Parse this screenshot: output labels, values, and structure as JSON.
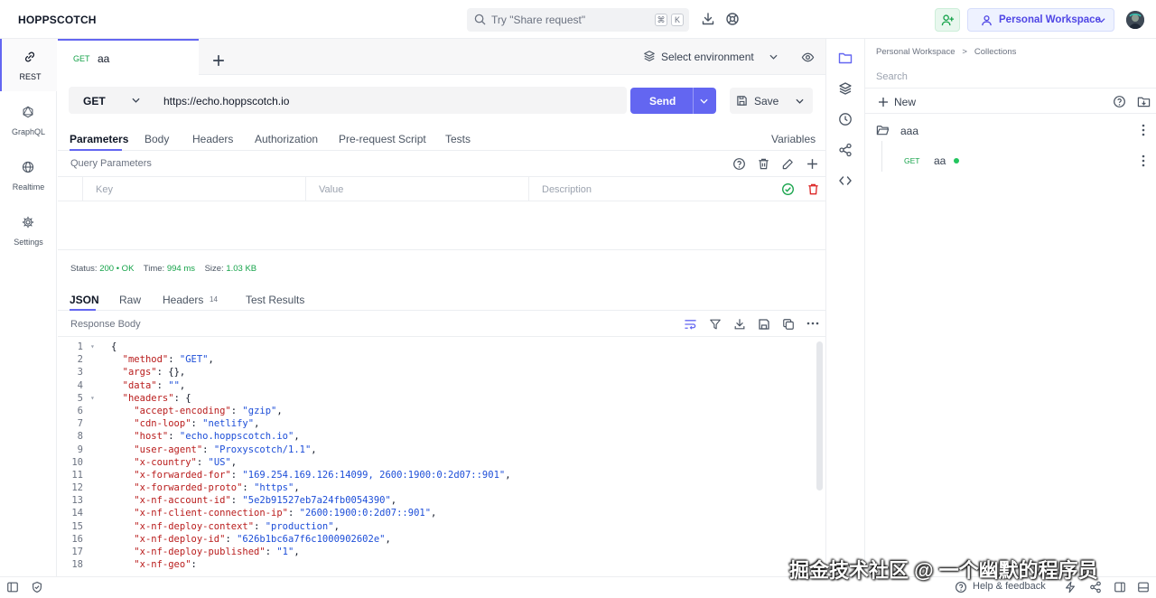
{
  "app": {
    "brand": "HOPPSCOTCH"
  },
  "header": {
    "search_placeholder": "Try \"Share request\"",
    "kbd_1": "⌘",
    "kbd_2": "K",
    "workspace_label": "Personal Workspace"
  },
  "leftnav": [
    {
      "label": "REST",
      "icon": "link-icon"
    },
    {
      "label": "GraphQL",
      "icon": "graphql-icon"
    },
    {
      "label": "Realtime",
      "icon": "globe-icon"
    },
    {
      "label": "Settings",
      "icon": "gear-icon"
    }
  ],
  "request_tab": {
    "method": "GET",
    "name": "aa"
  },
  "environment": {
    "label": "Select environment"
  },
  "urlbar": {
    "method": "GET",
    "url": "https://echo.hoppscotch.io",
    "send_label": "Send",
    "save_label": "Save"
  },
  "request_tabs": [
    "Parameters",
    "Body",
    "Headers",
    "Authorization",
    "Pre-request Script",
    "Tests"
  ],
  "variables_label": "Variables",
  "query_params": {
    "label": "Query Parameters",
    "key_placeholder": "Key",
    "value_placeholder": "Value",
    "description_placeholder": "Description"
  },
  "status": {
    "status_label": "Status:",
    "status_value": "200 • OK",
    "time_label": "Time:",
    "time_value": "994 ms",
    "size_label": "Size:",
    "size_value": "1.03 KB"
  },
  "response_tabs": [
    "JSON",
    "Raw",
    "Headers",
    "Test Results"
  ],
  "response_headers_count": "14",
  "response_body_label": "Response Body",
  "code_lines": [
    {
      "n": "1",
      "fold": "▾",
      "indent": 0,
      "key": "",
      "rest": "{"
    },
    {
      "n": "2",
      "fold": "",
      "indent": 1,
      "key": "\"method\"",
      "val": "\"GET\"",
      "tail": ","
    },
    {
      "n": "3",
      "fold": "",
      "indent": 1,
      "key": "\"args\"",
      "plain": "{}",
      "tail": ","
    },
    {
      "n": "4",
      "fold": "",
      "indent": 1,
      "key": "\"data\"",
      "val": "\"\"",
      "tail": ","
    },
    {
      "n": "5",
      "fold": "▾",
      "indent": 1,
      "key": "\"headers\"",
      "plain": "{",
      "tail": ""
    },
    {
      "n": "6",
      "fold": "",
      "indent": 2,
      "key": "\"accept-encoding\"",
      "val": "\"gzip\"",
      "tail": ","
    },
    {
      "n": "7",
      "fold": "",
      "indent": 2,
      "key": "\"cdn-loop\"",
      "val": "\"netlify\"",
      "tail": ","
    },
    {
      "n": "8",
      "fold": "",
      "indent": 2,
      "key": "\"host\"",
      "val": "\"echo.hoppscotch.io\"",
      "tail": ","
    },
    {
      "n": "9",
      "fold": "",
      "indent": 2,
      "key": "\"user-agent\"",
      "val": "\"Proxyscotch/1.1\"",
      "tail": ","
    },
    {
      "n": "10",
      "fold": "",
      "indent": 2,
      "key": "\"x-country\"",
      "val": "\"US\"",
      "tail": ","
    },
    {
      "n": "11",
      "fold": "",
      "indent": 2,
      "key": "\"x-forwarded-for\"",
      "val": "\"169.254.169.126:14099, 2600:1900:0:2d07::901\"",
      "tail": ","
    },
    {
      "n": "12",
      "fold": "",
      "indent": 2,
      "key": "\"x-forwarded-proto\"",
      "val": "\"https\"",
      "tail": ","
    },
    {
      "n": "13",
      "fold": "",
      "indent": 2,
      "key": "\"x-nf-account-id\"",
      "val": "\"5e2b91527eb7a24fb0054390\"",
      "tail": ","
    },
    {
      "n": "14",
      "fold": "",
      "indent": 2,
      "key": "\"x-nf-client-connection-ip\"",
      "val": "\"2600:1900:0:2d07::901\"",
      "tail": ","
    },
    {
      "n": "15",
      "fold": "",
      "indent": 2,
      "key": "\"x-nf-deploy-context\"",
      "val": "\"production\"",
      "tail": ","
    },
    {
      "n": "16",
      "fold": "",
      "indent": 2,
      "key": "\"x-nf-deploy-id\"",
      "val": "\"626b1bc6a7f6c1000902602e\"",
      "tail": ","
    },
    {
      "n": "17",
      "fold": "",
      "indent": 2,
      "key": "\"x-nf-deploy-published\"",
      "val": "\"1\"",
      "tail": ","
    },
    {
      "n": "18",
      "fold": "",
      "indent": 2,
      "key": "\"x-nf-geo\"",
      "plain": "",
      "tail": ""
    }
  ],
  "sidebar": {
    "breadcrumb_1": "Personal Workspace",
    "breadcrumb_sep": ">",
    "breadcrumb_2": "Collections",
    "search_placeholder": "Search",
    "new_label": "New",
    "collection_name": "aaa",
    "request_method": "GET",
    "request_name": "aa"
  },
  "footer": {
    "help_label": "Help & feedback"
  },
  "watermark": "掘金技术社区 @ 一个幽默的程序员",
  "colors": {
    "accent": "#6366f1",
    "success": "#16a34a",
    "key": "#b91c1c",
    "string": "#1d4ed8"
  }
}
